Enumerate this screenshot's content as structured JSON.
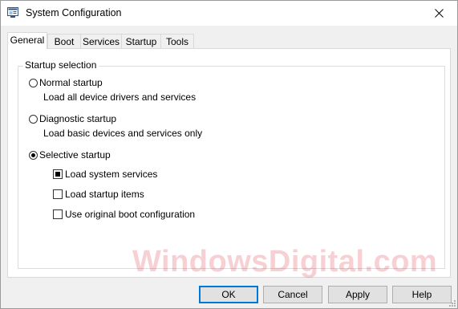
{
  "window": {
    "title": "System Configuration",
    "icon": "msconfig-icon"
  },
  "tabs": [
    {
      "label": "General",
      "active": true
    },
    {
      "label": "Boot",
      "active": false
    },
    {
      "label": "Services",
      "active": false
    },
    {
      "label": "Startup",
      "active": false
    },
    {
      "label": "Tools",
      "active": false
    }
  ],
  "startup_selection": {
    "legend": "Startup selection",
    "options": [
      {
        "label": "Normal startup",
        "description": "Load all device drivers and services",
        "checked": false
      },
      {
        "label": "Diagnostic startup",
        "description": "Load basic devices and services only",
        "checked": false
      },
      {
        "label": "Selective startup",
        "checked": true
      }
    ],
    "selective_items": [
      {
        "label": "Load system services",
        "state": "indeterminate"
      },
      {
        "label": "Load startup items",
        "state": "unchecked"
      },
      {
        "label": "Use original boot configuration",
        "state": "unchecked"
      }
    ]
  },
  "buttons": {
    "ok": "OK",
    "cancel": "Cancel",
    "apply": "Apply",
    "help": "Help"
  },
  "watermark": "WindowsDigital.com",
  "colors": {
    "default_button_border": "#0078d7",
    "watermark": "#dc283c"
  }
}
